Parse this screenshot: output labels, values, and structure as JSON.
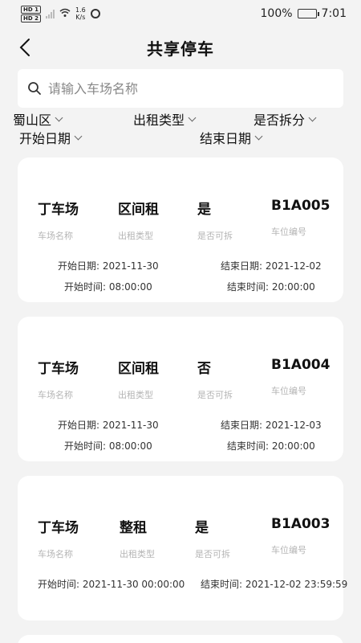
{
  "status": {
    "hd1": "HD 1",
    "hd2": "HD 2",
    "speed_value": "1.6",
    "speed_unit": "K/s",
    "battery_text": "100%",
    "time": "7:01"
  },
  "header": {
    "title": "共享停车"
  },
  "search": {
    "placeholder": "请输入车场名称"
  },
  "filters": {
    "district": "蜀山区",
    "rent_type": "出租类型",
    "divisible": "是否拆分",
    "start_date": "开始日期",
    "end_date": "结束日期"
  },
  "labels": {
    "lot_name": "车场名称",
    "rent_type": "出租类型",
    "divisible": "是否可拆",
    "space_no": "车位编号"
  },
  "cards": [
    {
      "lot": "丁车场",
      "type": "区间租",
      "divisible": "是",
      "space": "B1A005",
      "start_date": "开始日期: 2021-11-30",
      "end_date": "结束日期: 2021-12-02",
      "start_time": "开始时间: 08:00:00",
      "end_time": "结束时间: 20:00:00"
    },
    {
      "lot": "丁车场",
      "type": "区间租",
      "divisible": "否",
      "space": "B1A004",
      "start_date": "开始日期: 2021-11-30",
      "end_date": "结束日期: 2021-12-03",
      "start_time": "开始时间: 08:00:00",
      "end_time": "结束时间: 20:00:00"
    },
    {
      "lot": "丁车场",
      "type": "整租",
      "divisible": "是",
      "space": "B1A003",
      "start_time": "开始时间: 2021-11-30 00:00:00",
      "end_time": "结束时间: 2021-12-02 23:59:59"
    }
  ]
}
